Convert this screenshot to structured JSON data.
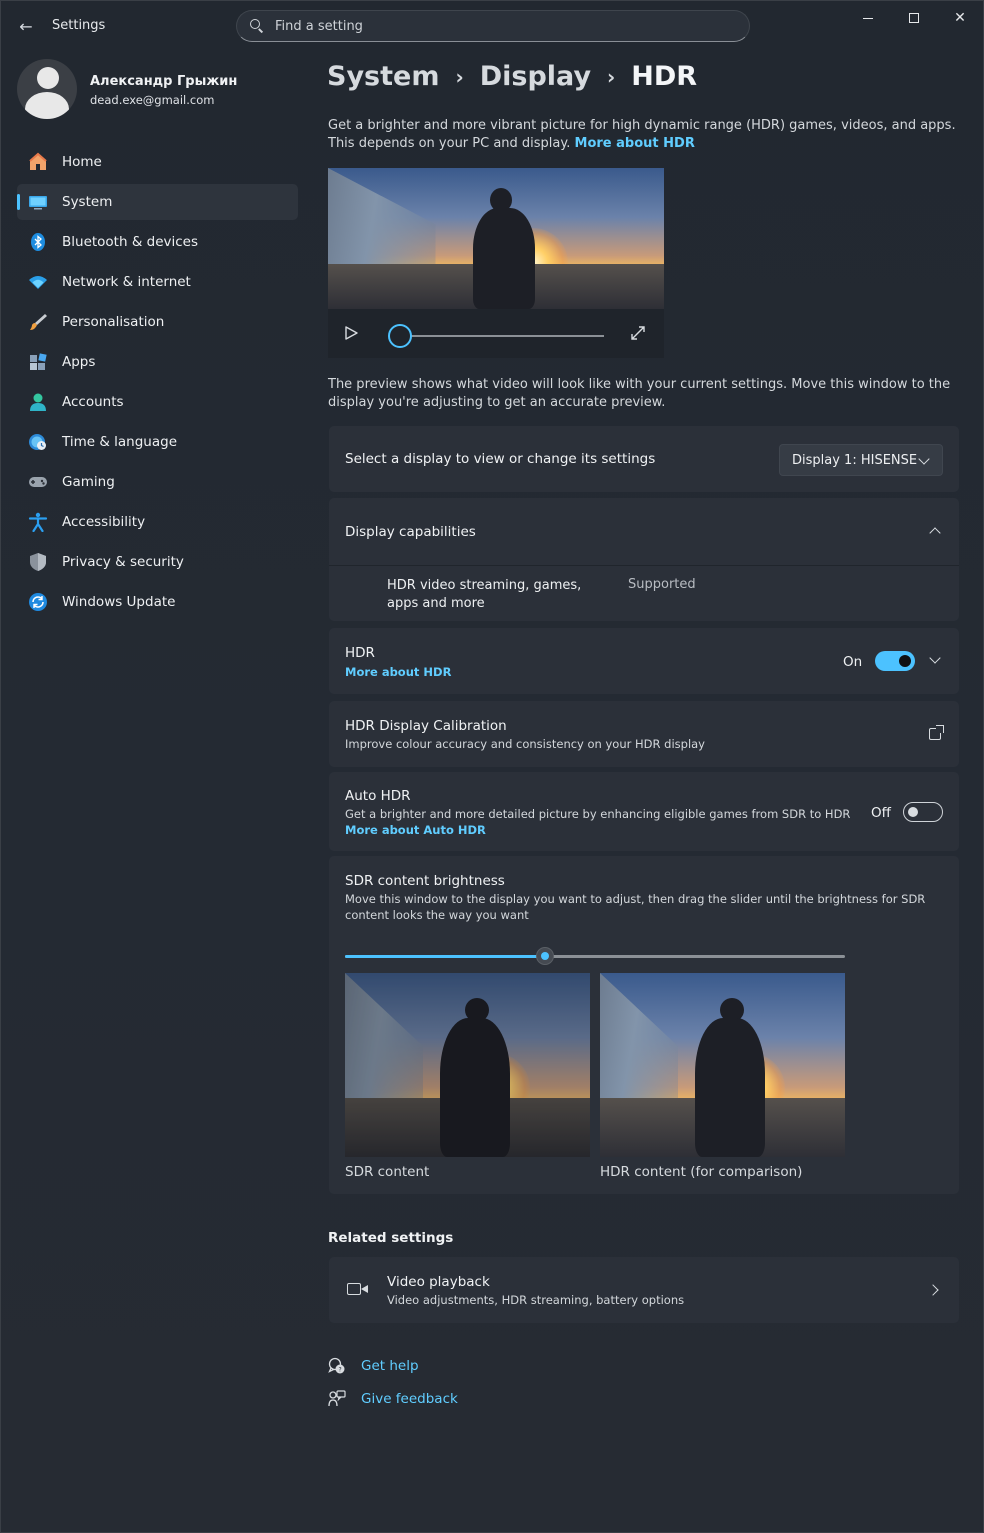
{
  "window": {
    "app_title": "Settings",
    "search_placeholder": "Find a setting"
  },
  "profile": {
    "name": "Александр Грыжин",
    "email": "dead.exe@gmail.com"
  },
  "sidebar": {
    "items": [
      {
        "label": "Home",
        "icon": "home-icon"
      },
      {
        "label": "System",
        "icon": "system-icon",
        "active": true
      },
      {
        "label": "Bluetooth & devices",
        "icon": "bluetooth-icon"
      },
      {
        "label": "Network & internet",
        "icon": "wifi-icon"
      },
      {
        "label": "Personalisation",
        "icon": "brush-icon"
      },
      {
        "label": "Apps",
        "icon": "apps-icon"
      },
      {
        "label": "Accounts",
        "icon": "accounts-icon"
      },
      {
        "label": "Time & language",
        "icon": "globe-clock-icon"
      },
      {
        "label": "Gaming",
        "icon": "gamepad-icon"
      },
      {
        "label": "Accessibility",
        "icon": "accessibility-icon"
      },
      {
        "label": "Privacy & security",
        "icon": "shield-icon"
      },
      {
        "label": "Windows Update",
        "icon": "update-icon"
      }
    ]
  },
  "breadcrumb": [
    "System",
    "Display",
    "HDR"
  ],
  "intro": {
    "text": "Get a brighter and more vibrant picture for high dynamic range (HDR) games, videos, and apps. This depends on your PC and display.",
    "link": "More about HDR"
  },
  "video_player": {
    "progress": 0
  },
  "preview_note": "The preview shows what video will look like with your current settings. Move this window to the display you're adjusting to get an accurate preview.",
  "display_select": {
    "label": "Select a display to view or change its settings",
    "value": "Display 1: HISENSE"
  },
  "capabilities": {
    "title": "Display capabilities",
    "feature": "HDR video streaming, games, apps and more",
    "status": "Supported"
  },
  "hdr": {
    "title": "HDR",
    "link": "More about HDR",
    "state_label": "On",
    "enabled": true
  },
  "calibration": {
    "title": "HDR Display Calibration",
    "subtitle": "Improve colour accuracy and consistency on your HDR display"
  },
  "auto_hdr": {
    "title": "Auto HDR",
    "subtitle": "Get a brighter and more detailed picture by enhancing eligible games from SDR to HDR",
    "link": "More about Auto HDR",
    "state_label": "Off",
    "enabled": false
  },
  "sdr_brightness": {
    "title": "SDR content brightness",
    "subtitle": "Move this window to the display you want to adjust, then drag the slider until the brightness for SDR content looks the way you want",
    "value": 0.4,
    "sdr_caption": "SDR content",
    "hdr_caption": "HDR content (for comparison)"
  },
  "related": {
    "heading": "Related settings",
    "video_playback": {
      "title": "Video playback",
      "subtitle": "Video adjustments, HDR streaming, battery options"
    }
  },
  "help": {
    "get_help": "Get help",
    "give_feedback": "Give feedback"
  },
  "colors": {
    "accent": "#4cc2ff",
    "link": "#60cdff",
    "card": "#2b3039",
    "background": "#222830"
  }
}
